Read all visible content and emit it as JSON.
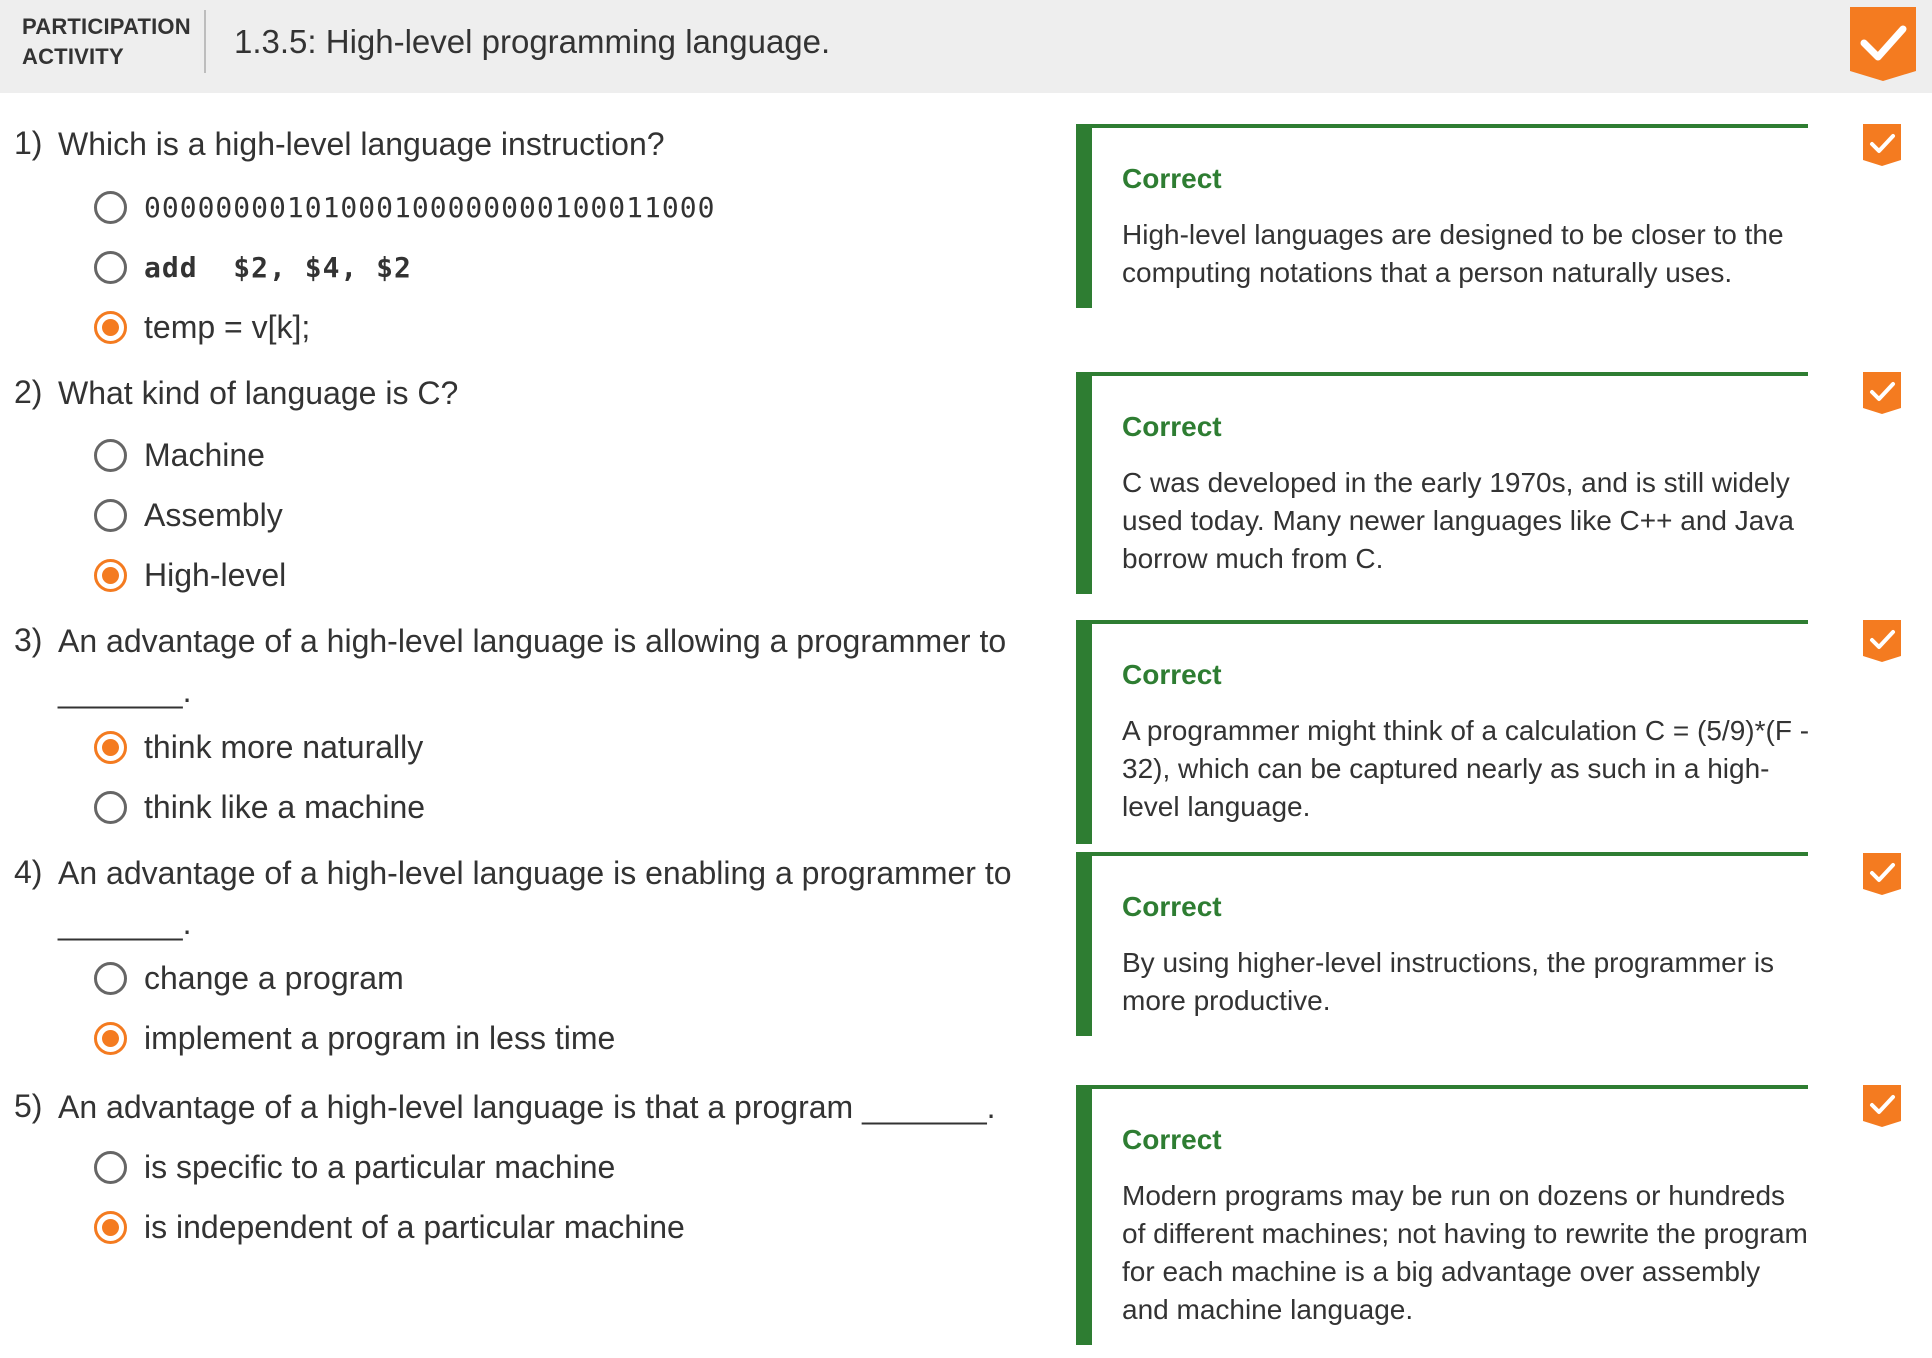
{
  "header": {
    "label_line1": "PARTICIPATION",
    "label_line2": "ACTIVITY",
    "title": "1.3.5: High-level programming language.",
    "completion_icon": "checkmark-badge-icon",
    "accent": "#f47b20"
  },
  "colors": {
    "accent": "#f47b20",
    "correct": "#2e7d32",
    "header_bg": "#eeeeee"
  },
  "questions": [
    {
      "number": "1)",
      "text": "Which is a high-level language instruction?",
      "options": [
        {
          "label": "00000000101000100000000100011000",
          "selected": false
        },
        {
          "label": "add  $2, $4, $2",
          "selected": false
        },
        {
          "label": "temp = v[k];",
          "selected": true
        }
      ],
      "feedback": {
        "title": "Correct",
        "text": "High-level languages are designed to be closer to the computing notations that a person naturally uses."
      }
    },
    {
      "number": "2)",
      "text": "What kind of language is C?",
      "options": [
        {
          "label": "Machine",
          "selected": false
        },
        {
          "label": "Assembly",
          "selected": false
        },
        {
          "label": "High-level",
          "selected": true
        }
      ],
      "feedback": {
        "title": "Correct",
        "text": "C was developed in the early 1970s, and is still widely used today. Many newer languages like C++ and Java borrow much from C."
      }
    },
    {
      "number": "3)",
      "text": "An advantage of a high-level language is allowing a programmer to _______.",
      "options": [
        {
          "label": "think more naturally",
          "selected": true
        },
        {
          "label": "think like a machine",
          "selected": false
        }
      ],
      "feedback": {
        "title": "Correct",
        "text": "A programmer might think of a calculation C = (5/9)*(F - 32), which can be captured nearly as such in a high-level language."
      }
    },
    {
      "number": "4)",
      "text": "An advantage of a high-level language is enabling a programmer to _______.",
      "options": [
        {
          "label": "change a program",
          "selected": false
        },
        {
          "label": "implement a program in less time",
          "selected": true
        }
      ],
      "feedback": {
        "title": "Correct",
        "text": "By using higher-level instructions, the programmer is more productive."
      }
    },
    {
      "number": "5)",
      "text": "An advantage of a high-level language is that a program _______.",
      "options": [
        {
          "label": "is specific to a particular machine",
          "selected": false
        },
        {
          "label": "is independent of a particular machine",
          "selected": true
        }
      ],
      "feedback": {
        "title": "Correct",
        "text": "Modern programs may be run on dozens or hundreds of different machines; not having to rewrite the program for each machine is a big advantage over assembly and machine language."
      }
    }
  ]
}
